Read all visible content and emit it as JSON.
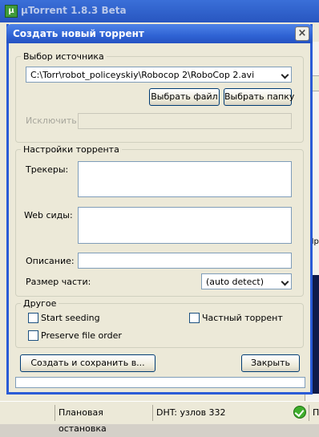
{
  "main_window": {
    "title": "µTorrent 1.8.3 Beta",
    "app_icon": "µ",
    "right_panel_text": "Пр"
  },
  "statusbar": {
    "scheduler": "Плановая остановка",
    "dht": "DHT: узлов 332",
    "tail": "П"
  },
  "dialog": {
    "title": "Создать новый торрент",
    "close_label": "×",
    "source": {
      "group_label": "Выбор источника",
      "path_value": "C:\\Torr\\robot_policeyskiy\\Robocop 2\\RoboCop 2.avi",
      "select_file_label": "Выбрать файл",
      "select_folder_label": "Выбрать папку",
      "exclude_label": "Исключить:"
    },
    "settings": {
      "group_label": "Настройки торрента",
      "trackers_label": "Трекеры:",
      "webseeds_label": "Web сиды:",
      "description_label": "Описание:",
      "piece_size_label": "Размер части:",
      "piece_size_value": "(auto detect)"
    },
    "other": {
      "group_label": "Другое",
      "start_seeding_label": "Start seeding",
      "private_label": "Частный торрент",
      "preserve_order_label": "Preserve file order"
    },
    "create_button_label": "Создать и сохранить в...",
    "close_button_label": "Закрыть"
  }
}
